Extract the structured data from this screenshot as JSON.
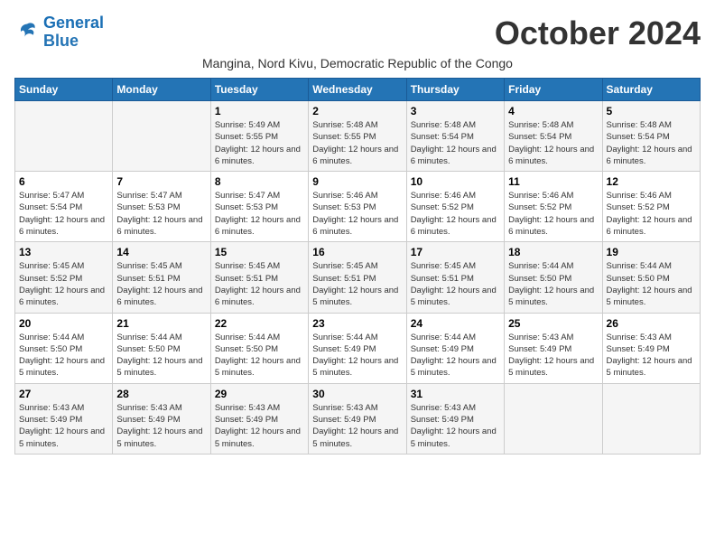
{
  "header": {
    "logo_line1": "General",
    "logo_line2": "Blue",
    "month": "October 2024",
    "subtitle": "Mangina, Nord Kivu, Democratic Republic of the Congo"
  },
  "days_of_week": [
    "Sunday",
    "Monday",
    "Tuesday",
    "Wednesday",
    "Thursday",
    "Friday",
    "Saturday"
  ],
  "weeks": [
    [
      {
        "day": "",
        "info": ""
      },
      {
        "day": "",
        "info": ""
      },
      {
        "day": "1",
        "info": "Sunrise: 5:49 AM\nSunset: 5:55 PM\nDaylight: 12 hours and 6 minutes."
      },
      {
        "day": "2",
        "info": "Sunrise: 5:48 AM\nSunset: 5:55 PM\nDaylight: 12 hours and 6 minutes."
      },
      {
        "day": "3",
        "info": "Sunrise: 5:48 AM\nSunset: 5:54 PM\nDaylight: 12 hours and 6 minutes."
      },
      {
        "day": "4",
        "info": "Sunrise: 5:48 AM\nSunset: 5:54 PM\nDaylight: 12 hours and 6 minutes."
      },
      {
        "day": "5",
        "info": "Sunrise: 5:48 AM\nSunset: 5:54 PM\nDaylight: 12 hours and 6 minutes."
      }
    ],
    [
      {
        "day": "6",
        "info": "Sunrise: 5:47 AM\nSunset: 5:54 PM\nDaylight: 12 hours and 6 minutes."
      },
      {
        "day": "7",
        "info": "Sunrise: 5:47 AM\nSunset: 5:53 PM\nDaylight: 12 hours and 6 minutes."
      },
      {
        "day": "8",
        "info": "Sunrise: 5:47 AM\nSunset: 5:53 PM\nDaylight: 12 hours and 6 minutes."
      },
      {
        "day": "9",
        "info": "Sunrise: 5:46 AM\nSunset: 5:53 PM\nDaylight: 12 hours and 6 minutes."
      },
      {
        "day": "10",
        "info": "Sunrise: 5:46 AM\nSunset: 5:52 PM\nDaylight: 12 hours and 6 minutes."
      },
      {
        "day": "11",
        "info": "Sunrise: 5:46 AM\nSunset: 5:52 PM\nDaylight: 12 hours and 6 minutes."
      },
      {
        "day": "12",
        "info": "Sunrise: 5:46 AM\nSunset: 5:52 PM\nDaylight: 12 hours and 6 minutes."
      }
    ],
    [
      {
        "day": "13",
        "info": "Sunrise: 5:45 AM\nSunset: 5:52 PM\nDaylight: 12 hours and 6 minutes."
      },
      {
        "day": "14",
        "info": "Sunrise: 5:45 AM\nSunset: 5:51 PM\nDaylight: 12 hours and 6 minutes."
      },
      {
        "day": "15",
        "info": "Sunrise: 5:45 AM\nSunset: 5:51 PM\nDaylight: 12 hours and 6 minutes."
      },
      {
        "day": "16",
        "info": "Sunrise: 5:45 AM\nSunset: 5:51 PM\nDaylight: 12 hours and 5 minutes."
      },
      {
        "day": "17",
        "info": "Sunrise: 5:45 AM\nSunset: 5:51 PM\nDaylight: 12 hours and 5 minutes."
      },
      {
        "day": "18",
        "info": "Sunrise: 5:44 AM\nSunset: 5:50 PM\nDaylight: 12 hours and 5 minutes."
      },
      {
        "day": "19",
        "info": "Sunrise: 5:44 AM\nSunset: 5:50 PM\nDaylight: 12 hours and 5 minutes."
      }
    ],
    [
      {
        "day": "20",
        "info": "Sunrise: 5:44 AM\nSunset: 5:50 PM\nDaylight: 12 hours and 5 minutes."
      },
      {
        "day": "21",
        "info": "Sunrise: 5:44 AM\nSunset: 5:50 PM\nDaylight: 12 hours and 5 minutes."
      },
      {
        "day": "22",
        "info": "Sunrise: 5:44 AM\nSunset: 5:50 PM\nDaylight: 12 hours and 5 minutes."
      },
      {
        "day": "23",
        "info": "Sunrise: 5:44 AM\nSunset: 5:49 PM\nDaylight: 12 hours and 5 minutes."
      },
      {
        "day": "24",
        "info": "Sunrise: 5:44 AM\nSunset: 5:49 PM\nDaylight: 12 hours and 5 minutes."
      },
      {
        "day": "25",
        "info": "Sunrise: 5:43 AM\nSunset: 5:49 PM\nDaylight: 12 hours and 5 minutes."
      },
      {
        "day": "26",
        "info": "Sunrise: 5:43 AM\nSunset: 5:49 PM\nDaylight: 12 hours and 5 minutes."
      }
    ],
    [
      {
        "day": "27",
        "info": "Sunrise: 5:43 AM\nSunset: 5:49 PM\nDaylight: 12 hours and 5 minutes."
      },
      {
        "day": "28",
        "info": "Sunrise: 5:43 AM\nSunset: 5:49 PM\nDaylight: 12 hours and 5 minutes."
      },
      {
        "day": "29",
        "info": "Sunrise: 5:43 AM\nSunset: 5:49 PM\nDaylight: 12 hours and 5 minutes."
      },
      {
        "day": "30",
        "info": "Sunrise: 5:43 AM\nSunset: 5:49 PM\nDaylight: 12 hours and 5 minutes."
      },
      {
        "day": "31",
        "info": "Sunrise: 5:43 AM\nSunset: 5:49 PM\nDaylight: 12 hours and 5 minutes."
      },
      {
        "day": "",
        "info": ""
      },
      {
        "day": "",
        "info": ""
      }
    ]
  ]
}
